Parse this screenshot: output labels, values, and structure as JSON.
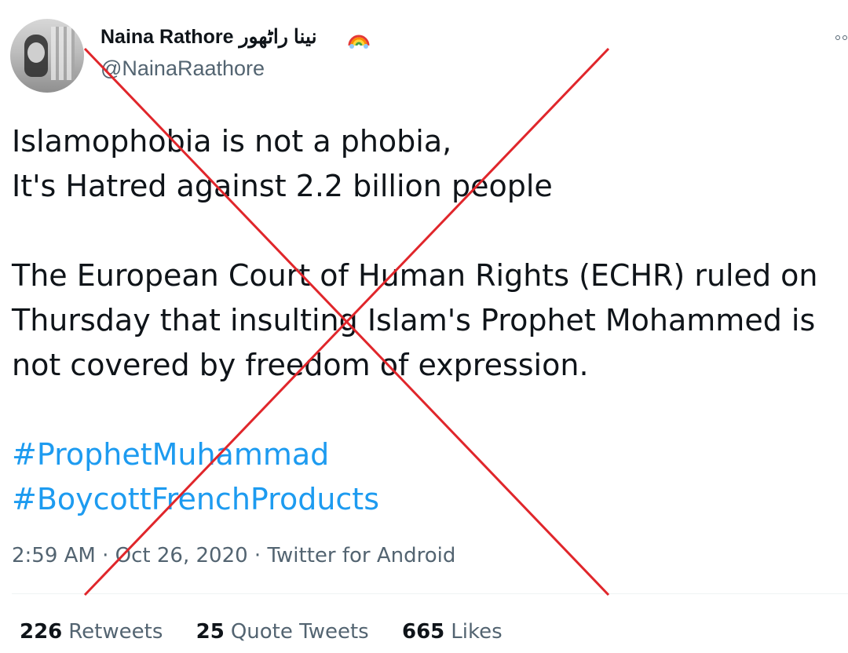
{
  "tweet": {
    "author": {
      "display_name": "Naina Rathore نینا راٹھور",
      "handle": "@NainaRaathore",
      "emoji_icon": "rainbow-icon"
    },
    "lines": [
      "Islamophobia is not a phobia,",
      "It's Hatred against 2.2 billion people",
      "The European Court of Human Rights (ECHR) ruled on",
      "Thursday that insulting Islam's Prophet Mohammed is",
      "not covered by freedom of expression."
    ],
    "hashtags": [
      "#ProphetMuhammad",
      "#BoycottFrenchProducts"
    ],
    "meta": "2:59 AM · Oct 26, 2020 · Twitter for Android",
    "stats": [
      {
        "count": "226",
        "label": "Retweets"
      },
      {
        "count": "25",
        "label": "Quote Tweets"
      },
      {
        "count": "665",
        "label": "Likes"
      }
    ]
  },
  "colors": {
    "text": "#0f1419",
    "secondary": "#536471",
    "hashtag": "#1d9bf0",
    "overlay_red": "#e0262b"
  }
}
